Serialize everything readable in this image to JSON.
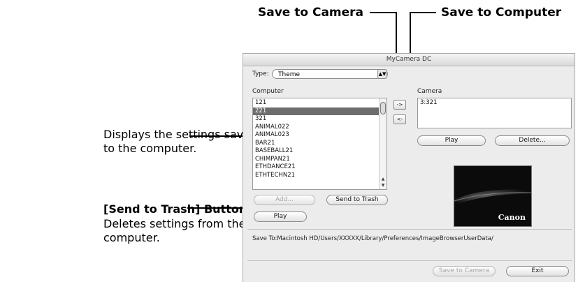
{
  "callouts": {
    "save_to_camera": "Save to Camera",
    "save_to_computer": "Save to Computer",
    "displays_line1": "Displays the settings saved",
    "displays_line2": "to the computer.",
    "trash_title": "[Send to Trash] Button",
    "trash_line1": "Deletes settings from the",
    "trash_line2": "computer."
  },
  "window": {
    "title": "MyCamera DC",
    "type_label": "Type:",
    "type_value": "Theme",
    "computer_label": "Computer",
    "camera_label": "Camera",
    "computer_items": [
      "121",
      "221",
      "321",
      "ANIMAL022",
      "ANIMAL023",
      "BAR21",
      "BASEBALL21",
      "CHIMPAN21",
      "ETHDANCE21",
      "ETHTECHN21"
    ],
    "computer_selected": "221",
    "camera_items": [
      "3:321"
    ],
    "to_camera_arrow": "->",
    "to_computer_arrow": "<-",
    "add_label": "Add...",
    "send_to_trash_label": "Send to Trash",
    "play_left_label": "Play",
    "play_right_label": "Play",
    "delete_label": "Delete...",
    "preview_brand": "Canon",
    "save_path": "Save To:Macintosh HD/Users/XXXXX/Library/Preferences/ImageBrowserUserData/",
    "save_to_camera_button": "Save to Camera",
    "exit_label": "Exit"
  },
  "colors": {
    "selection": "#6d6d6d",
    "window_bg": "#ececec",
    "preview_bg": "#0b0b0b"
  }
}
